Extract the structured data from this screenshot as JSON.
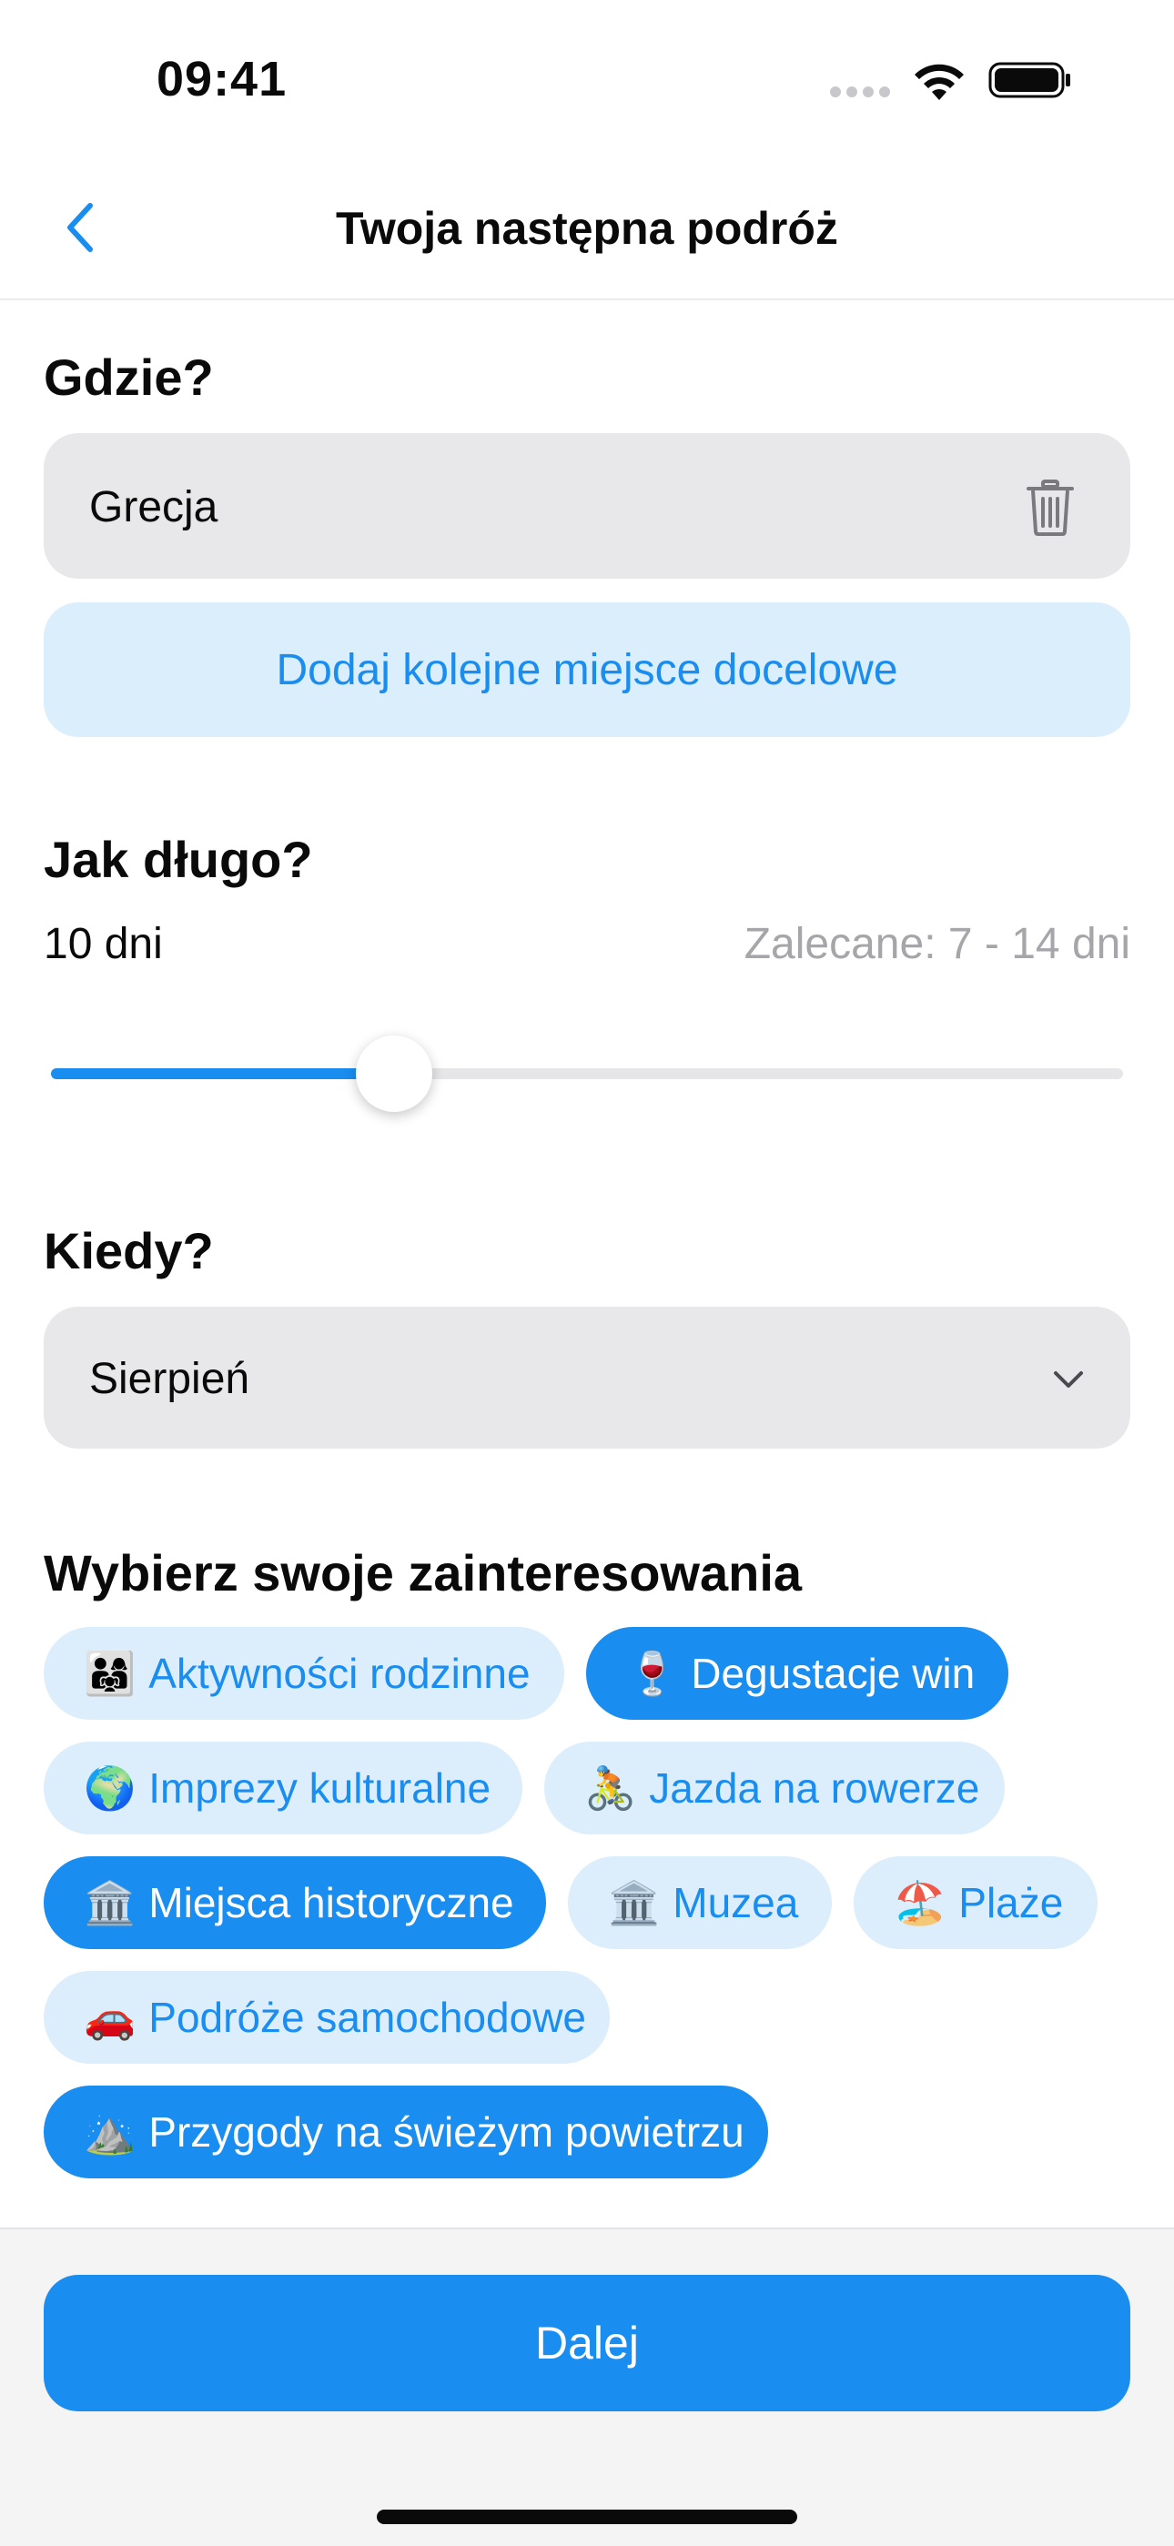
{
  "status_bar": {
    "time": "09:41"
  },
  "nav": {
    "title": "Twoja następna podróż"
  },
  "where": {
    "title": "Gdzie?",
    "destination": "Grecja",
    "add_destination_label": "Dodaj kolejne miejsce docelowe"
  },
  "how_long": {
    "title": "Jak długo?",
    "duration": "10 dni",
    "recommended": "Zalecane: 7 - 14 dni",
    "slider_fraction": 0.32
  },
  "when": {
    "title": "Kiedy?",
    "selected_month": "Sierpień"
  },
  "interests": {
    "title": "Wybierz swoje zainteresowania",
    "chips": [
      {
        "emoji": "👨‍👩‍👧",
        "label": "Aktywności rodzinne",
        "selected": false
      },
      {
        "emoji": "🍷",
        "label": "Degustacje win",
        "selected": true
      },
      {
        "emoji": "🌍",
        "label": "Imprezy kulturalne",
        "selected": false
      },
      {
        "emoji": "🚴",
        "label": "Jazda na rowerze",
        "selected": false
      },
      {
        "emoji": "🏛️",
        "label": "Miejsca historyczne",
        "selected": true
      },
      {
        "emoji": "🏛️",
        "label": "Muzea",
        "selected": false
      },
      {
        "emoji": "🏖️",
        "label": "Plaże",
        "selected": false
      },
      {
        "emoji": "🚗",
        "label": "Podróże samochodowe",
        "selected": false
      },
      {
        "emoji": "⛰️",
        "label": "Przygody na świeżym powietrzu",
        "selected": true
      }
    ]
  },
  "footer": {
    "next_label": "Dalej"
  },
  "colors": {
    "accent": "#1a8df0",
    "chip_bg": "#dcedfb",
    "field_bg": "#e8e8ea"
  }
}
